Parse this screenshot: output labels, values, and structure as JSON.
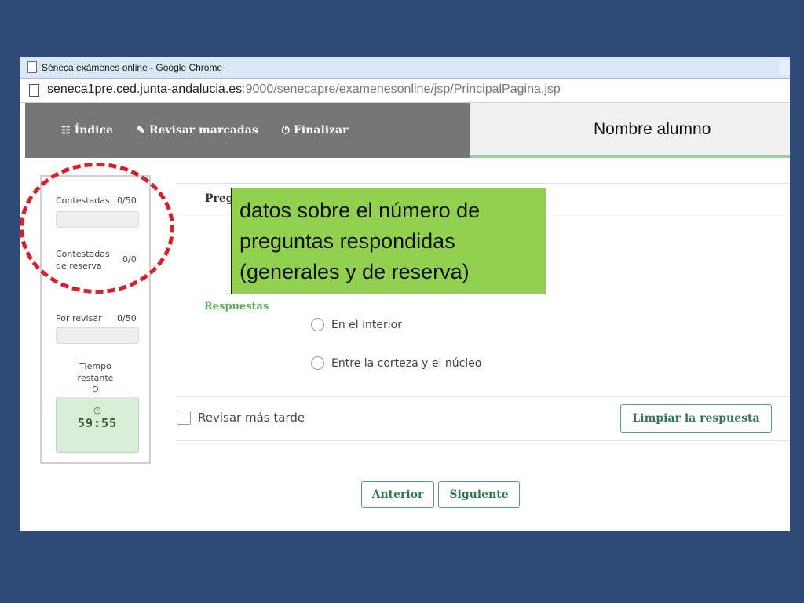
{
  "window": {
    "title": "Séneca exámenes online - Google Chrome",
    "url_host": "seneca1pre.ced.junta-andalucia.es",
    "url_path": ":9000/senecapre/examenesonline/jsp/PrincipalPagina.jsp"
  },
  "app": {
    "menu": [
      {
        "label": "Índice",
        "icon": "sitemap-icon"
      },
      {
        "label": "Revisar marcadas",
        "icon": "pencil-icon"
      },
      {
        "label": "Finalizar",
        "icon": "power-icon"
      }
    ],
    "student_name": "Nombre alumno"
  },
  "sidebar": {
    "answered_label": "Contestadas",
    "answered_value": "0/50",
    "reserve_label_1": "Contestadas",
    "reserve_label_2": "de reserva",
    "reserve_value": "0/0",
    "review_label": "Por revisar",
    "review_value": "0/50",
    "time_label_1": "Tiempo",
    "time_label_2": "restante",
    "timer_value": "59:55"
  },
  "question": {
    "title_visible": "Preg",
    "answers_label": "Respuestas",
    "options": [
      "En el interior",
      "Entre la corteza y el núcleo"
    ],
    "review_later_label": "Revisar más tarde",
    "clear_button": "Limpiar la respuesta"
  },
  "navigation": {
    "previous": "Anterior",
    "next": "Siguiente"
  },
  "annotation": {
    "text": "datos sobre el número de preguntas respondidas (generales y de reserva)"
  },
  "colors": {
    "slide_background": "#2e4a77",
    "app_bar": "#767676",
    "accent_green": "#2f7a52",
    "annotation_fill": "#92d050",
    "highlight_circle": "#d0232e"
  }
}
